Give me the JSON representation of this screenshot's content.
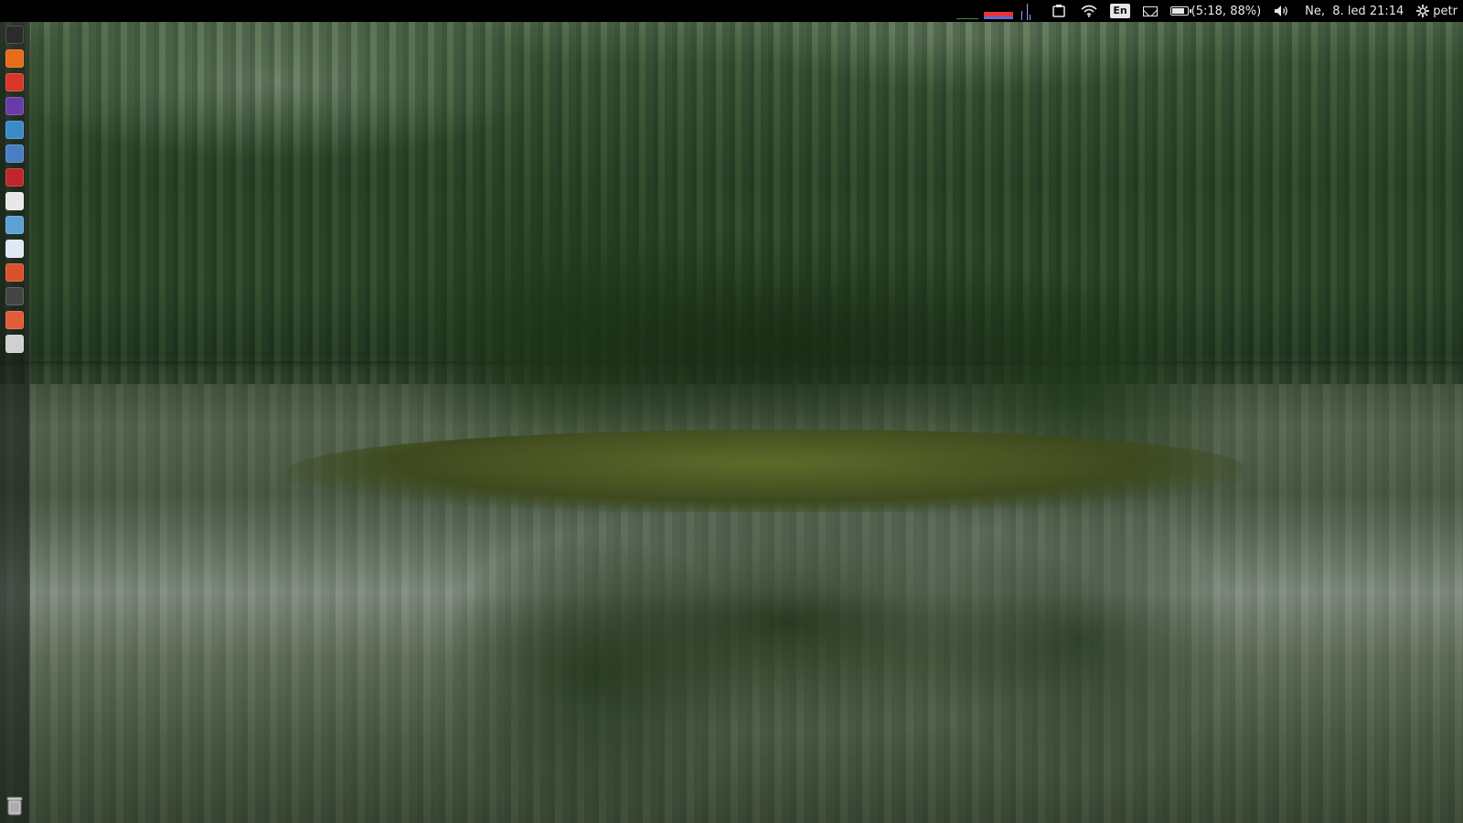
{
  "top_panel": {
    "keyboard_layout": "En",
    "battery": {
      "label": "(5:18, 88%)",
      "level_percent": 88
    },
    "clock": "Ne,  8. led 21:14",
    "user": "petr"
  },
  "launcher": {
    "items": [
      {
        "icon": "dash-home-icon",
        "color": "#2b2b2b"
      },
      {
        "icon": "firefox-icon",
        "color": "#e66b1a"
      },
      {
        "icon": "crossover-icon",
        "color": "#d9362a"
      },
      {
        "icon": "media-player-icon",
        "color": "#6a3aa8"
      },
      {
        "icon": "image-viewer-icon",
        "color": "#3d8ac9"
      },
      {
        "icon": "system-settings-icon",
        "color": "#4a7ec4"
      },
      {
        "icon": "terminal-app-icon",
        "color": "#c0262b"
      },
      {
        "icon": "text-editor-icon",
        "color": "#e8e8e8"
      },
      {
        "icon": "web-browser-icon",
        "color": "#5da0d6"
      },
      {
        "icon": "document-icon",
        "color": "#dfe8f5"
      },
      {
        "icon": "disk-tool-icon",
        "color": "#d8512a"
      },
      {
        "icon": "drive-icon",
        "color": "#444444"
      },
      {
        "icon": "calendar-app-icon",
        "color": "#e25b3a"
      },
      {
        "icon": "file-manager-icon",
        "color": "#d0d0d0"
      }
    ],
    "trash_icon": "trash-icon"
  }
}
